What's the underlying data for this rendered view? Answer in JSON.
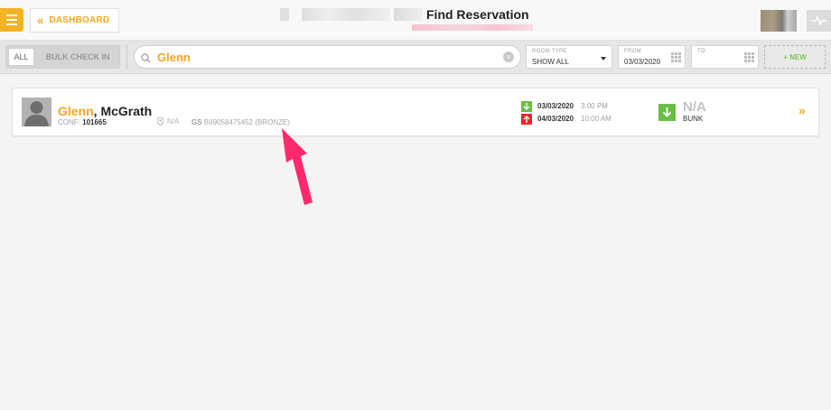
{
  "header": {
    "title": "Find Reservation",
    "dashboard_label": "DASHBOARD"
  },
  "filters": {
    "all_label": "ALL",
    "bulk_checkin_label": "BULK CHECK IN",
    "search_value": "Glenn",
    "room_type": {
      "label": "ROOM TYPE",
      "value": "SHOW ALL"
    },
    "from": {
      "label": "FROM",
      "value": "03/03/2020"
    },
    "to": {
      "label": "TO",
      "value": ""
    },
    "new_label": "+ NEW"
  },
  "reservation": {
    "first_name": "Glenn",
    "last_name": ", McGrath",
    "conf_label": "CONF:",
    "conf_number": "101665",
    "location": "N/A",
    "gs_label": "GS",
    "gs_value": "BII9058475452 (BRONZE)",
    "arrival": {
      "date": "03/03/2020",
      "time": "3:00 PM"
    },
    "departure": {
      "date": "04/03/2020",
      "time": "10:00 AM"
    },
    "room_number": "N/A",
    "room_type": "BUNK",
    "open_label": "»"
  },
  "colors": {
    "accent": "#f5a623",
    "arrival": "#6abd45",
    "departure": "#e8262a",
    "annotation": "#ff2a6d"
  }
}
